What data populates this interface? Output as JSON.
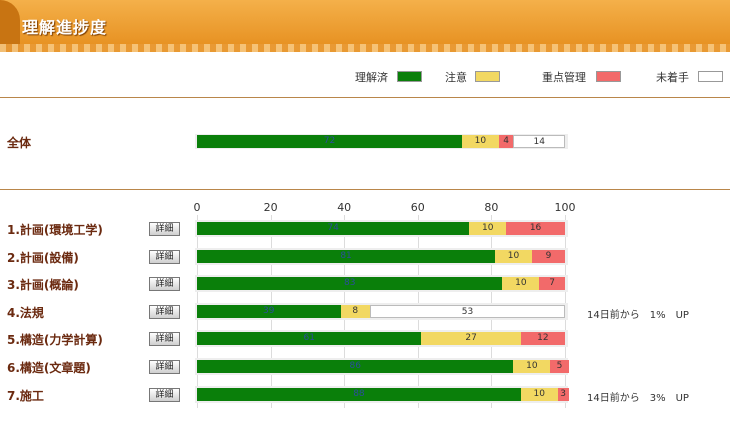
{
  "page_title": "理解進捗度",
  "legend": [
    {
      "label": "理解済",
      "color": "#0a7f0a"
    },
    {
      "label": "注意",
      "color": "#f2d862"
    },
    {
      "label": "重点管理",
      "color": "#f26a6a"
    },
    {
      "label": "未着手",
      "color": "#ffffff"
    }
  ],
  "detail_label": "詳細",
  "axis_ticks": [
    "0",
    "20",
    "40",
    "60",
    "80",
    "100"
  ],
  "overall": {
    "label": "全体",
    "green": 72,
    "yellow": 10,
    "red": 4,
    "white": 14
  },
  "subjects": [
    {
      "label": "1.計画(環境工学)",
      "green": 74,
      "yellow": 10,
      "red": 16,
      "white": 0,
      "note": ""
    },
    {
      "label": "2.計画(設備)",
      "green": 81,
      "yellow": 10,
      "red": 9,
      "white": 0,
      "note": ""
    },
    {
      "label": "3.計画(概論)",
      "green": 83,
      "yellow": 10,
      "red": 7,
      "white": 0,
      "note": ""
    },
    {
      "label": "4.法規",
      "green": 39,
      "yellow": 8,
      "red": 0,
      "white": 53,
      "note": "14日前から　1%　UP"
    },
    {
      "label": "5.構造(力学計算)",
      "green": 61,
      "yellow": 27,
      "red": 12,
      "white": 0,
      "note": ""
    },
    {
      "label": "6.構造(文章題)",
      "green": 86,
      "yellow": 10,
      "red": 5,
      "white": 0,
      "note": ""
    },
    {
      "label": "7.施工",
      "green": 88,
      "yellow": 10,
      "red": 3,
      "white": 0,
      "note": "14日前から　3%　UP"
    }
  ]
}
